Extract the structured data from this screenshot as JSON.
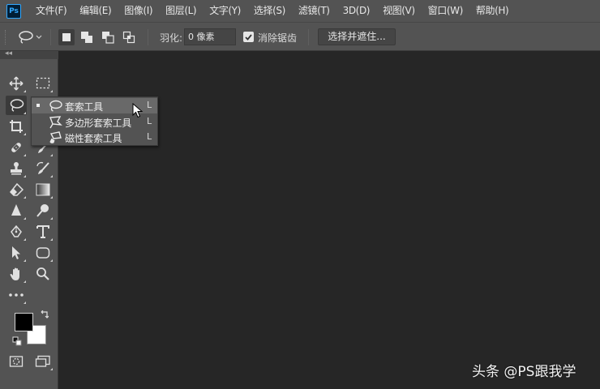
{
  "app": {
    "logo_text": "Ps"
  },
  "menu": [
    "文件(F)",
    "编辑(E)",
    "图像(I)",
    "图层(L)",
    "文字(Y)",
    "选择(S)",
    "滤镜(T)",
    "3D(D)",
    "视图(V)",
    "窗口(W)",
    "帮助(H)"
  ],
  "options_bar": {
    "tool_icon": "lasso-icon",
    "feather_label": "羽化:",
    "feather_value": "0 像素",
    "antialias_label": "消除锯齿",
    "antialias_checked": true,
    "select_mask_label": "选择并遮住..."
  },
  "toolbar": {
    "collapse_glyph": "◂◂",
    "foreground_color": "#000000",
    "background_color": "#ffffff"
  },
  "flyout": {
    "items": [
      {
        "label": "套索工具",
        "shortcut": "L",
        "icon": "lasso-icon",
        "selected": true
      },
      {
        "label": "多边形套索工具",
        "shortcut": "L",
        "icon": "polygonal-lasso-icon",
        "selected": false
      },
      {
        "label": "磁性套索工具",
        "shortcut": "L",
        "icon": "magnetic-lasso-icon",
        "selected": false
      }
    ]
  },
  "watermark": "头条 @PS跟我学",
  "colors": {
    "menubar": "#535353",
    "canvas": "#262626",
    "accent": "#31a8ff"
  }
}
